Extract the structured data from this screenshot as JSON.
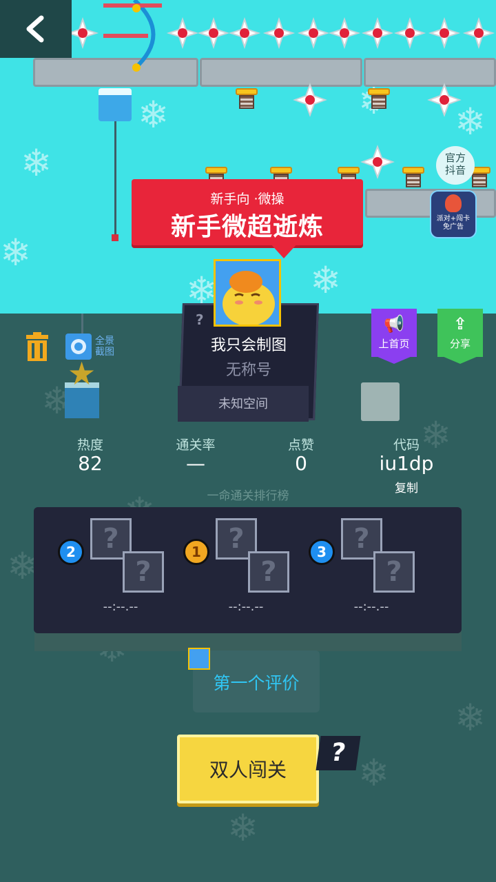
{
  "nav": {
    "back_icon": "chevron-left-icon"
  },
  "banner": {
    "subtitle": "新手向 ·微操",
    "title": "新手微超逝炼"
  },
  "author": {
    "name": "我只会制图",
    "title": "无称号",
    "space": "未知空间",
    "unknown_mark": "?"
  },
  "side_buttons": {
    "homepage_label": "上首页",
    "share_label": "分享",
    "official_badge": "官方\n抖音",
    "promo_text": "派对+闯卡\n免广告"
  },
  "tools": {
    "fullshot_label": "全景\n截图"
  },
  "stats": [
    {
      "label": "热度",
      "value": "82"
    },
    {
      "label": "通关率",
      "value": "—"
    },
    {
      "label": "点赞",
      "value": "0"
    },
    {
      "label": "代码",
      "value": "iu1dp"
    }
  ],
  "copy_label": "复制",
  "leaderboard": {
    "title": "一命通关排行榜",
    "entries": [
      {
        "rank": "2",
        "time": "--:--.--"
      },
      {
        "rank": "1",
        "time": "--:--.--"
      },
      {
        "rank": "3",
        "time": "--:--.--"
      }
    ]
  },
  "comment": {
    "label": "第一个评价"
  },
  "coop": {
    "label": "双人闯关",
    "help": "?"
  },
  "colors": {
    "sky": "#3fe3e6",
    "ground": "#2f5f5e",
    "banner": "#e8253a",
    "homepage": "#8b3ff0",
    "share": "#3fc35a",
    "coop": "#f6d640"
  }
}
